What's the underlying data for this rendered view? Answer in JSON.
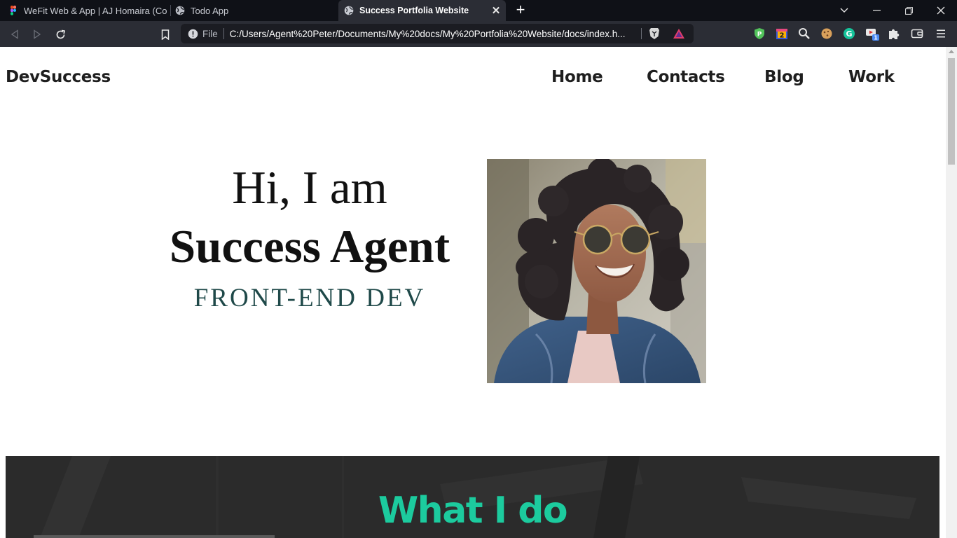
{
  "browser": {
    "tabs": [
      {
        "title": "WeFit Web & App | AJ Homaira (Community)",
        "icon": "figma-icon"
      },
      {
        "title": "Todo App",
        "icon": "globe-icon"
      },
      {
        "title": "Success Portfolia Website",
        "icon": "globe-icon",
        "active": true
      }
    ],
    "address": {
      "scheme_label": "File",
      "url": "C:/Users/Agent%20Peter/Documents/My%20docs/My%20Portfolia%20Website/docs/index.h..."
    },
    "extensions": [
      "vpn-shield-icon",
      "calendar-2-icon",
      "search-icon",
      "cookie-icon",
      "grammarly-icon",
      "media-icon",
      "puzzle-icon"
    ],
    "extension_badge": "1",
    "colors": {
      "tabbar": "#0f1117",
      "toolbar": "#2b2d35"
    }
  },
  "site": {
    "brand": "DevSuccess",
    "nav": [
      "Home",
      "Contacts",
      "Blog",
      "Work"
    ],
    "hero": {
      "greeting": "Hi, I am",
      "name": "Success Agent",
      "role": "FRONT-END DEV"
    },
    "section": {
      "title": "What I do"
    },
    "colors": {
      "accent": "#1ccb9e",
      "role_text": "#1f4949",
      "section_bg": "#2b2b2b"
    }
  }
}
